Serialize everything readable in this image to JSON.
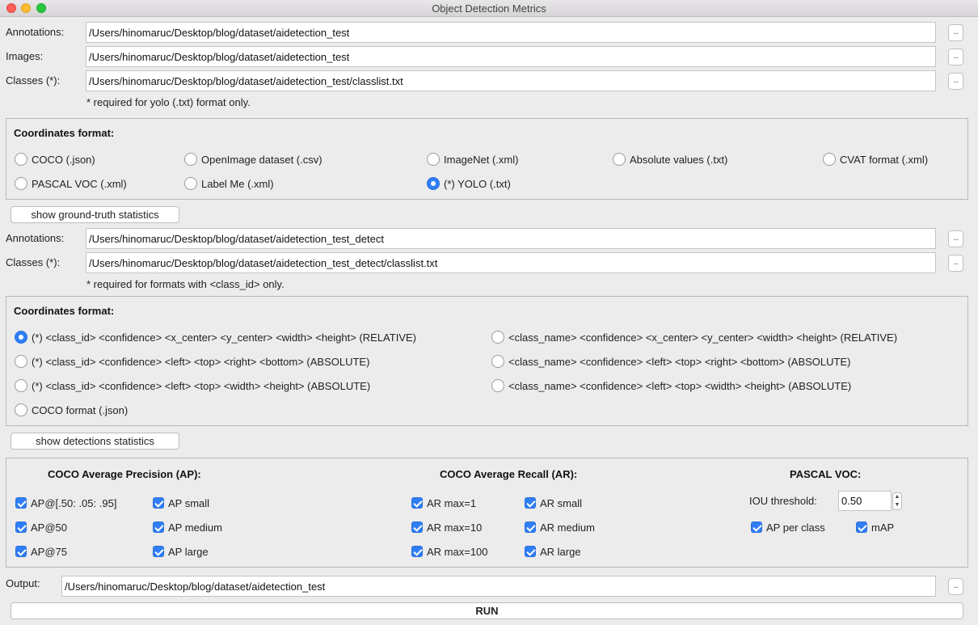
{
  "window": {
    "title": "Object Detection Metrics"
  },
  "ground_truth": {
    "annotations_label": "Annotations:",
    "annotations_value": "/Users/hinomaruc/Desktop/blog/dataset/aidetection_test",
    "images_label": "Images:",
    "images_value": "/Users/hinomaruc/Desktop/blog/dataset/aidetection_test",
    "classes_label": "Classes (*):",
    "classes_value": "/Users/hinomaruc/Desktop/blog/dataset/aidetection_test/classlist.txt",
    "browse_label": "..",
    "note": "* required for yolo (.txt) format only.",
    "format_title": "Coordinates format:",
    "formats": [
      "COCO (.json)",
      "OpenImage dataset (.csv)",
      "ImageNet (.xml)",
      "Absolute values (.txt)",
      "CVAT format (.xml)",
      "PASCAL VOC (.xml)",
      "Label Me (.xml)",
      "(*) YOLO (.txt)"
    ],
    "selected_format": "(*) YOLO (.txt)",
    "stats_button": "show ground-truth statistics"
  },
  "detections": {
    "annotations_label": "Annotations:",
    "annotations_value": "/Users/hinomaruc/Desktop/blog/dataset/aidetection_test_detect",
    "classes_label": "Classes (*):",
    "classes_value": "/Users/hinomaruc/Desktop/blog/dataset/aidetection_test_detect/classlist.txt",
    "browse_label": "..",
    "note": "* required for formats with <class_id> only.",
    "format_title": "Coordinates format:",
    "formats": [
      "(*) <class_id> <confidence> <x_center> <y_center> <width> <height> (RELATIVE)",
      "<class_name> <confidence> <x_center> <y_center> <width> <height> (RELATIVE)",
      "(*) <class_id> <confidence> <left> <top> <right> <bottom> (ABSOLUTE)",
      "<class_name> <confidence> <left> <top> <right> <bottom> (ABSOLUTE)",
      "(*) <class_id> <confidence> <left> <top> <width> <height> (ABSOLUTE)",
      "<class_name> <confidence> <left> <top> <width> <height> (ABSOLUTE)",
      "COCO format (.json)"
    ],
    "selected_format": "(*) <class_id> <confidence> <x_center> <y_center> <width> <height> (RELATIVE)",
    "stats_button": "show detections statistics"
  },
  "metrics": {
    "ap_title": "COCO Average Precision (AP):",
    "ap_items": [
      "AP@[.50: .05: .95]",
      "AP small",
      "AP@50",
      "AP medium",
      "AP@75",
      "AP large"
    ],
    "ar_title": "COCO Average Recall (AR):",
    "ar_items": [
      "AR max=1",
      "AR small",
      "AR max=10",
      "AR medium",
      "AR max=100",
      "AR large"
    ],
    "voc_title": "PASCAL VOC:",
    "iou_label": "IOU threshold:",
    "iou_value": "0.50",
    "voc_items": [
      "AP per class",
      "mAP"
    ],
    "all_checked": true
  },
  "output": {
    "label": "Output:",
    "value": "/Users/hinomaruc/Desktop/blog/dataset/aidetection_test",
    "browse_label": ".."
  },
  "run_label": "RUN",
  "colors": {
    "accent": "#2f7ef6"
  }
}
